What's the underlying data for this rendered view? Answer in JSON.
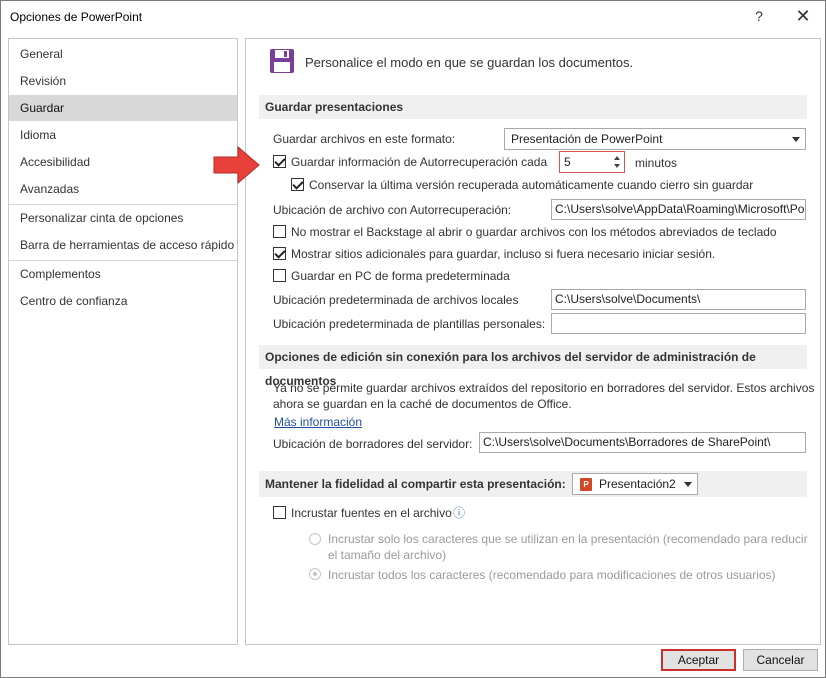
{
  "window": {
    "title": "Opciones de PowerPoint",
    "help_glyph": "?",
    "close_glyph": "✕"
  },
  "sidebar": {
    "items": [
      {
        "label": "General"
      },
      {
        "label": "Revisión"
      },
      {
        "label": "Guardar",
        "active": true
      },
      {
        "label": "Idioma"
      },
      {
        "label": "Accesibilidad"
      },
      {
        "label": "Avanzadas"
      },
      {
        "label": "Personalizar cinta de opciones"
      },
      {
        "label": "Barra de herramientas de acceso rápido"
      },
      {
        "label": "Complementos"
      },
      {
        "label": "Centro de confianza"
      }
    ]
  },
  "main": {
    "header": {
      "icon": "floppy-disk-icon",
      "text": "Personalice el modo en que se guardan los documentos."
    },
    "save_section": {
      "title": "Guardar presentaciones",
      "format_label": "Guardar archivos en este formato:",
      "format_value": "Presentación de PowerPoint",
      "autorecover_label": "Guardar información de Autorrecuperación cada",
      "autorecover_minutes": "5",
      "minutes_label": "minutos",
      "autorecover_checked": true,
      "keep_last_label": "Conservar la última versión recuperada automáticamente cuando cierro sin guardar",
      "keep_last_checked": true,
      "autorecover_location_label": "Ubicación de archivo con Autorrecuperación:",
      "autorecover_location_value": "C:\\Users\\solve\\AppData\\Roaming\\Microsoft\\Po",
      "no_backstage_label": "No mostrar el Backstage al abrir o guardar archivos con los métodos abreviados de teclado",
      "no_backstage_checked": false,
      "show_places_label": "Mostrar sitios adicionales para guardar, incluso si fuera necesario iniciar sesión.",
      "show_places_checked": true,
      "save_pc_label": "Guardar en PC de forma predeterminada",
      "save_pc_checked": false,
      "local_location_label": "Ubicación predeterminada de archivos locales",
      "local_location_value": "C:\\Users\\solve\\Documents\\",
      "templates_location_label": "Ubicación predeterminada de plantillas personales:",
      "templates_location_value": ""
    },
    "offline_section": {
      "title": "Opciones de edición sin conexión para los archivos del servidor de administración de documentos",
      "info_line1": "Ya no se permite guardar archivos extraídos del repositorio en borradores del servidor. Estos archivos",
      "info_line2": "ahora se guardan en la caché de documentos de Office.",
      "more_info_link": "Más información",
      "drafts_label": "Ubicación de borradores del servidor:",
      "drafts_value": "C:\\Users\\solve\\Documents\\Borradores de SharePoint\\"
    },
    "fidelity_section": {
      "title": "Mantener la fidelidad al compartir esta presentación:",
      "presentation_value": "Presentación2",
      "embed_fonts_label": "Incrustar fuentes en el archivo",
      "embed_fonts_checked": false,
      "info_glyph": "ⓘ",
      "option_subset_line1": "Incrustar solo los caracteres que se utilizan  en la presentación (recomendado para reducir",
      "option_subset_line2": "el tamaño del archivo)",
      "option_all_label": "Incrustar todos los caracteres (recomendado para modificaciones de otros usuarios)"
    }
  },
  "footer": {
    "accept_label": "Aceptar",
    "cancel_label": "Cancelar"
  },
  "colors": {
    "accent_red": "#e8403a",
    "active_nav": "#d8d8d8",
    "section_bg": "#f0f0f0",
    "link": "#1f4e9e"
  }
}
